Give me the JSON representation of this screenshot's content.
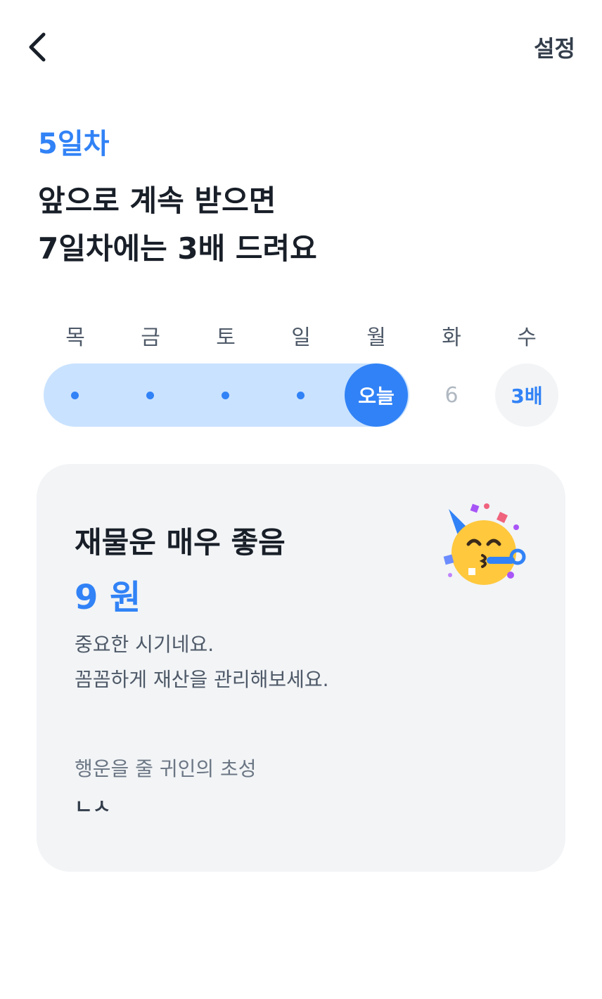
{
  "header": {
    "settings_label": "설정"
  },
  "streak": {
    "day_label": "5일차",
    "headline_line1": "앞으로 계속 받으면",
    "headline_line2": "7일차에는 3배 드려요"
  },
  "week": {
    "days": [
      "목",
      "금",
      "토",
      "일",
      "월",
      "화",
      "수"
    ],
    "completed_days": 4,
    "today_label": "오늘",
    "next_day_number": "6",
    "bonus_label": "3배"
  },
  "fortune": {
    "title": "재물운 매우 좋음",
    "amount": "9 원",
    "description_line1": "중요한 시기네요.",
    "description_line2": "꼼꼼하게 재산을 관리해보세요.",
    "hint_label": "행운을 줄 귀인의 초성",
    "hint_value": "ㄴㅅ",
    "emoji": "partying-face-icon"
  },
  "colors": {
    "accent": "#3182f6",
    "track": "#c9e2ff",
    "card_bg": "#f2f4f6"
  }
}
